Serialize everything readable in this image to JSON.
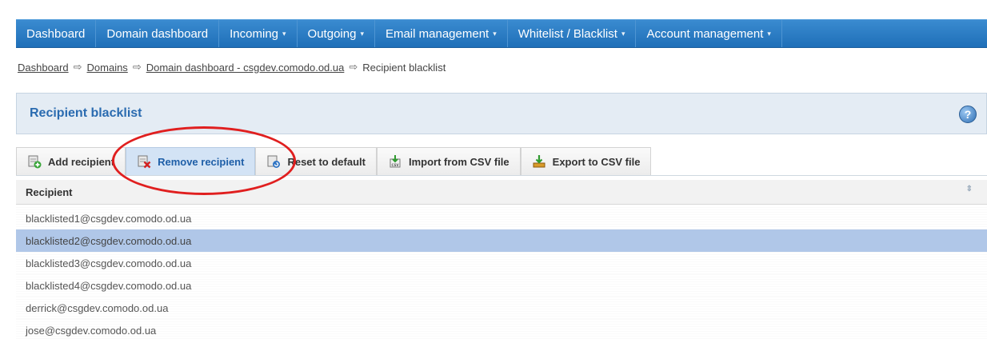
{
  "nav": {
    "items": [
      {
        "label": "Dashboard",
        "dropdown": false
      },
      {
        "label": "Domain dashboard",
        "dropdown": false
      },
      {
        "label": "Incoming",
        "dropdown": true
      },
      {
        "label": "Outgoing",
        "dropdown": true
      },
      {
        "label": "Email management",
        "dropdown": true
      },
      {
        "label": "Whitelist / Blacklist",
        "dropdown": true
      },
      {
        "label": "Account management",
        "dropdown": true
      }
    ],
    "caret": "▾"
  },
  "breadcrumb": {
    "items": [
      "Dashboard",
      "Domains",
      "Domain dashboard - csgdev.comodo.od.ua"
    ],
    "current": "Recipient blacklist",
    "separator": "⇨"
  },
  "panel": {
    "title": "Recipient blacklist",
    "help_icon": "?"
  },
  "toolbar": {
    "add_label": "Add recipient",
    "remove_label": "Remove recipient",
    "reset_label": "Reset to default",
    "import_label": "Import from CSV file",
    "export_label": "Export to CSV file"
  },
  "table": {
    "column_header": "Recipient",
    "sort_icon": "⇕",
    "rows": [
      "blacklisted1@csgdev.comodo.od.ua",
      "blacklisted2@csgdev.comodo.od.ua",
      "blacklisted3@csgdev.comodo.od.ua",
      "blacklisted4@csgdev.comodo.od.ua",
      "derrick@csgdev.comodo.od.ua",
      "jose@csgdev.comodo.od.ua"
    ],
    "selected_index": 1
  },
  "colors": {
    "nav_bg": "#2a7cc6",
    "title": "#2a6bb0",
    "selected_row": "#b0c7e8",
    "annotation": "#e01f1f"
  }
}
